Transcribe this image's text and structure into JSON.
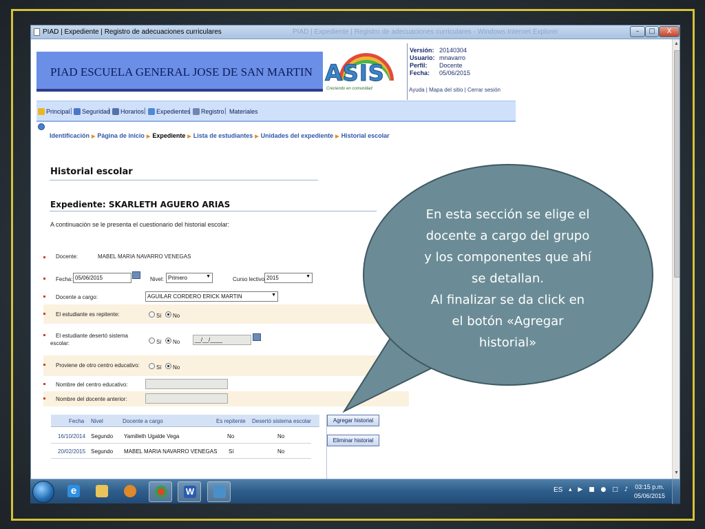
{
  "window": {
    "title": "PIAD | Expediente | Registro de adecuaciones curriculares",
    "ghost_title": "PIAD | Expediente | Registro de adecuaciones curriculares - Windows Internet Explorer",
    "min_glyph": "–",
    "max_glyph": "□",
    "close_glyph": "X"
  },
  "header": {
    "school_name": "PIAD ESCUELA GENERAL JOSE DE SAN MARTIN",
    "logo_text": "ASIS",
    "logo_tagline": "Creciendo en comunidad",
    "info": [
      {
        "label": "Versión:",
        "value": "20140304"
      },
      {
        "label": "Usuario:",
        "value": "mnavarro"
      },
      {
        "label": "Perfil:",
        "value": "Docente"
      },
      {
        "label": "Fecha:",
        "value": "05/06/2015"
      }
    ],
    "help_links": "Ayuda | Mapa del sitio | Cerrar sesión"
  },
  "menu": {
    "items": [
      {
        "label": "Principal",
        "icon": "star-icon",
        "color": "#e8b820"
      },
      {
        "label": "Seguridad",
        "icon": "users-icon",
        "color": "#4a78c8"
      },
      {
        "label": "Horarios",
        "icon": "calendar-icon",
        "color": "#5472a8"
      },
      {
        "label": "Expedientes",
        "icon": "folder-icon",
        "color": "#4d8ad6"
      },
      {
        "label": "Registro",
        "icon": "register-icon",
        "color": "#6f86b2"
      },
      {
        "label": "Materiales",
        "icon": "",
        "color": ""
      }
    ],
    "separator": "|"
  },
  "breadcrumb": {
    "items": [
      "Identificación",
      "Página de inicio",
      "Expediente",
      "Lista de estudiantes",
      "Unidades del expediente",
      "Historial escolar"
    ],
    "current_index": 2,
    "separator": "▶"
  },
  "page": {
    "title": "Historial escolar",
    "expediente": "Expediente: SKARLETH AGUERO ARIAS",
    "intro": "A continuación se le presenta el cuestionario del historial escolar:"
  },
  "form": {
    "docente_label": "Docente:",
    "docente_value": "MABEL MARIA NAVARRO VENEGAS",
    "fecha_label": "Fecha:",
    "fecha_value": "05/06/2015",
    "nivel_label": "Nivel:",
    "nivel_value": "Primero",
    "curso_label": "Curso lectivo:",
    "curso_value": "2015",
    "docente_cargo_label": "Docente a cargo:",
    "docente_cargo_value": "AGUILAR CORDERO ERICK MARTIN",
    "repitente_label": "El estudiante es repitente:",
    "desertó_label_1": "El estudiante desertó sistema",
    "desertó_label_2": "escolar:",
    "desertó_date_value": "__/__/____",
    "otro_centro_label": "Proviene de otro centro educativo:",
    "nombre_centro_label": "Nombre del centro educativo:",
    "nombre_docente_label": "Nombre del docente anterior:",
    "si_label": "Sí",
    "no_label": "No",
    "select_arrow": "▼"
  },
  "history_table": {
    "columns": [
      "Fecha",
      "Nivel",
      "Docente a cargo",
      "Es repitente",
      "Desertó sistema escolar"
    ],
    "rows": [
      [
        "16/10/2014",
        "Segundo",
        "Yamilleth Ugalde Vega",
        "No",
        "No"
      ],
      [
        "20/02/2015",
        "Segundo",
        "MABEL MARIA NAVARRO VENEGAS",
        "Sí",
        "No"
      ]
    ]
  },
  "buttons": {
    "agregar": "Agregar historial",
    "eliminar": "Eliminar historial"
  },
  "callout": {
    "lines": [
      "En esta sección se elige el",
      "docente a cargo del grupo",
      "y los componentes que ahí",
      "se detallan.",
      "Al finalizar se da click en",
      "el botón «Agregar",
      "historial»"
    ]
  },
  "taskbar": {
    "apps": [
      {
        "name": "internet-explorer-icon",
        "color": "#2f8fe0",
        "glyph": "e"
      },
      {
        "name": "file-explorer-icon",
        "color": "#e9c45a",
        "glyph": ""
      },
      {
        "name": "media-player-icon",
        "color": "#e0882a",
        "glyph": ""
      },
      {
        "name": "chrome-icon",
        "color": "#d9452f",
        "glyph": ""
      },
      {
        "name": "word-icon",
        "color": "#2a5db0",
        "glyph": "W"
      },
      {
        "name": "remote-desktop-icon",
        "color": "#4a90c8",
        "glyph": ""
      }
    ],
    "language": "ES",
    "tray_icons": "▴ ▶ ■ ● □ ♪",
    "time": "03:15 p.m.",
    "date": "05/06/2015"
  }
}
